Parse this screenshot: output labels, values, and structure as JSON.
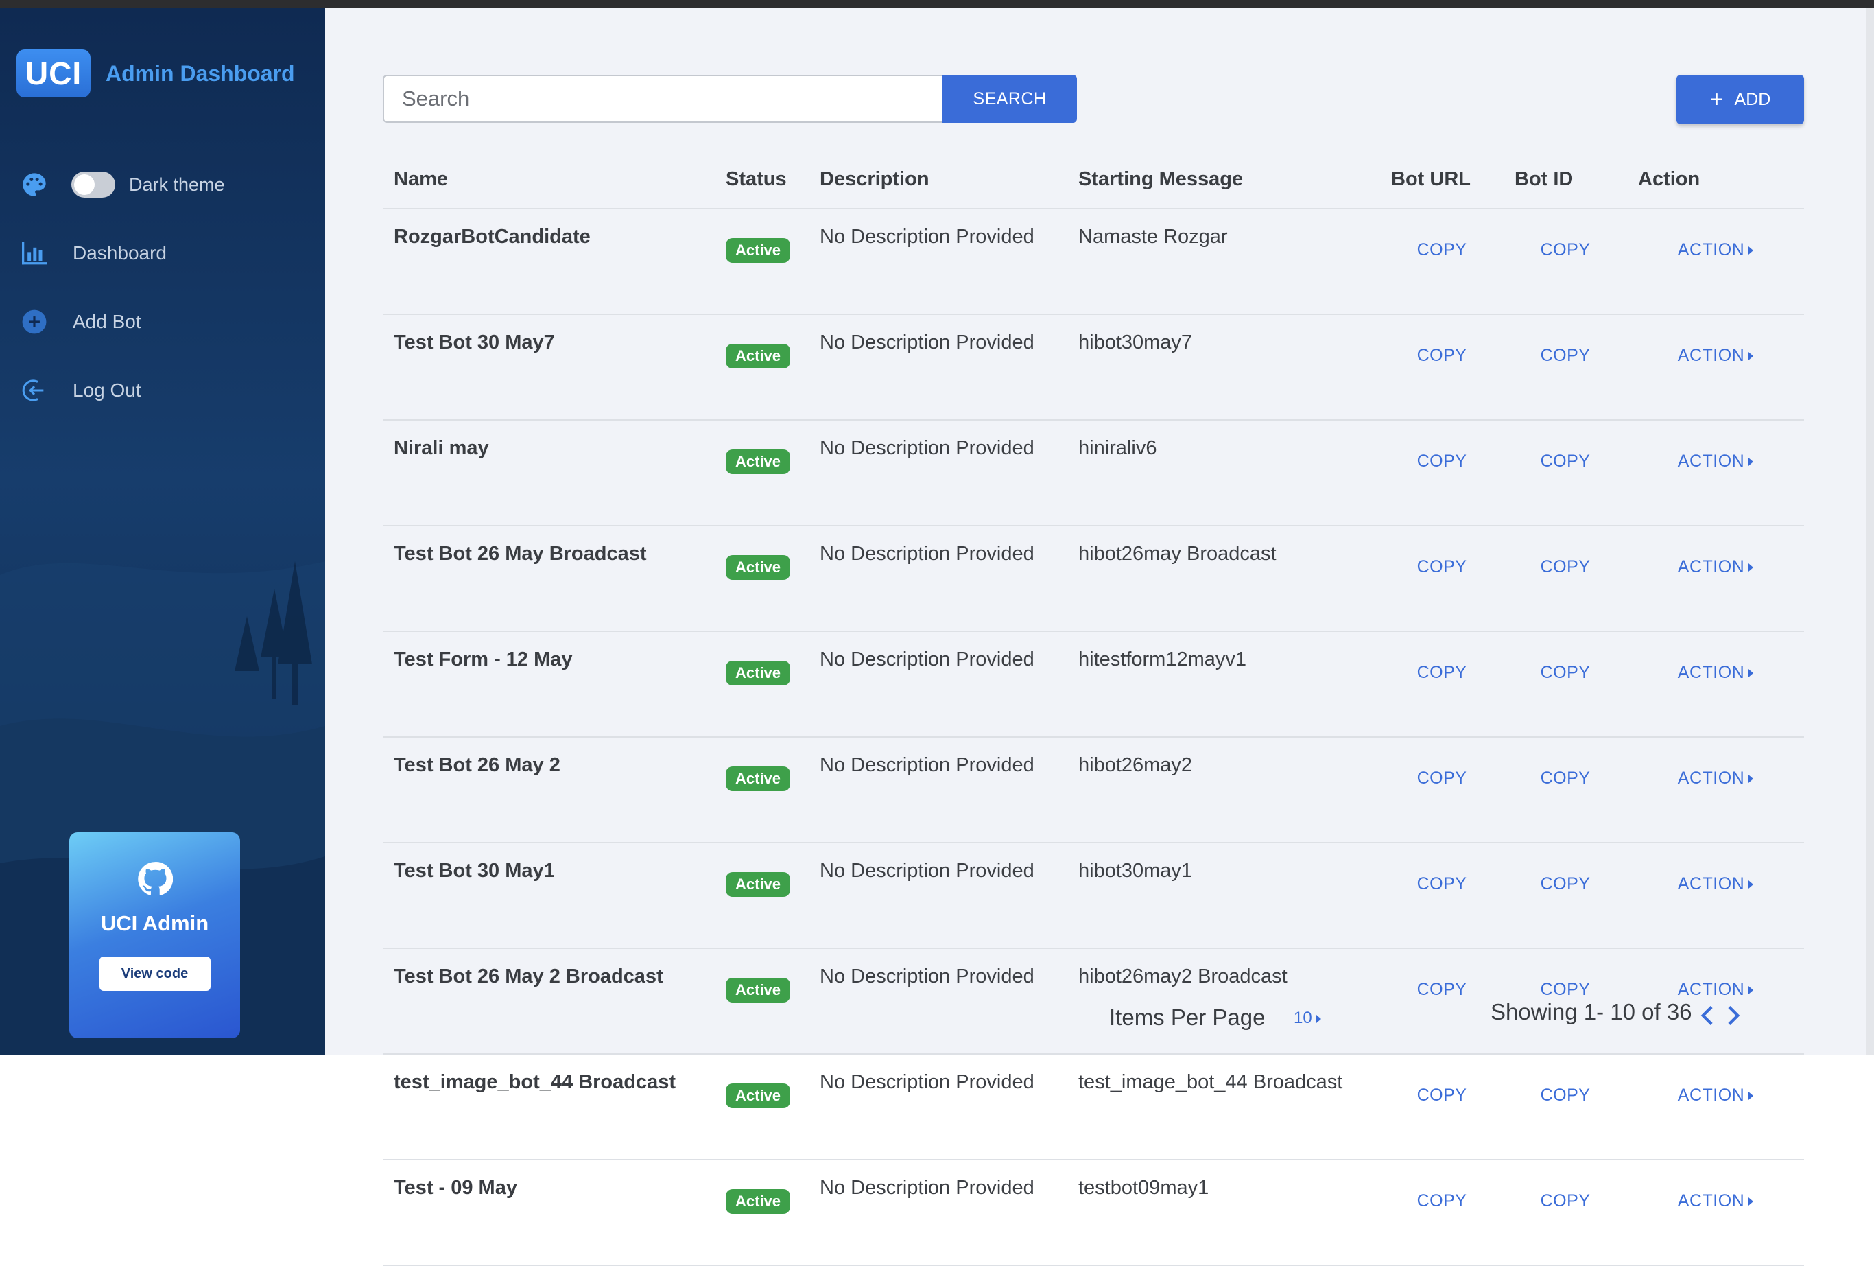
{
  "app": {
    "logo_text": "UCI",
    "title": "Admin Dashboard"
  },
  "sidebar": {
    "theme_toggle": {
      "label": "Dark theme",
      "enabled": false
    },
    "items": [
      {
        "label": "Dashboard",
        "icon": "bar-chart-icon"
      },
      {
        "label": "Add Bot",
        "icon": "plus-circle-icon"
      },
      {
        "label": "Log Out",
        "icon": "logout-icon"
      }
    ],
    "promo": {
      "title": "UCI Admin",
      "button": "View code",
      "icon": "github-icon"
    }
  },
  "toolbar": {
    "search_placeholder": "Search",
    "search_button": "SEARCH",
    "add_button": "ADD"
  },
  "table": {
    "columns": [
      "Name",
      "Status",
      "Description",
      "Starting Message",
      "Bot URL",
      "Bot ID",
      "Action"
    ],
    "rows": [
      {
        "name": "RozgarBotCandidate",
        "status": "Active",
        "description": "No Description Provided",
        "starting_message": "Namaste Rozgar",
        "bot_url": "COPY",
        "bot_id": "COPY",
        "action": "ACTION"
      },
      {
        "name": "Test Bot 30 May7",
        "status": "Active",
        "description": "No Description Provided",
        "starting_message": "hibot30may7",
        "bot_url": "COPY",
        "bot_id": "COPY",
        "action": "ACTION"
      },
      {
        "name": "Nirali may",
        "status": "Active",
        "description": "No Description Provided",
        "starting_message": "hiniraliv6",
        "bot_url": "COPY",
        "bot_id": "COPY",
        "action": "ACTION"
      },
      {
        "name": "Test Bot 26 May Broadcast",
        "status": "Active",
        "description": "No Description Provided",
        "starting_message": "hibot26may Broadcast",
        "bot_url": "COPY",
        "bot_id": "COPY",
        "action": "ACTION"
      },
      {
        "name": "Test Form - 12 May",
        "status": "Active",
        "description": "No Description Provided",
        "starting_message": "hitestform12mayv1",
        "bot_url": "COPY",
        "bot_id": "COPY",
        "action": "ACTION"
      },
      {
        "name": "Test Bot 26 May 2",
        "status": "Active",
        "description": "No Description Provided",
        "starting_message": "hibot26may2",
        "bot_url": "COPY",
        "bot_id": "COPY",
        "action": "ACTION"
      },
      {
        "name": "Test Bot 30 May1",
        "status": "Active",
        "description": "No Description Provided",
        "starting_message": "hibot30may1",
        "bot_url": "COPY",
        "bot_id": "COPY",
        "action": "ACTION"
      },
      {
        "name": "Test Bot 26 May 2 Broadcast",
        "status": "Active",
        "description": "No Description Provided",
        "starting_message": "hibot26may2 Broadcast",
        "bot_url": "COPY",
        "bot_id": "COPY",
        "action": "ACTION"
      },
      {
        "name": "test_image_bot_44 Broadcast",
        "status": "Active",
        "description": "No Description Provided",
        "starting_message": "test_image_bot_44 Broadcast",
        "bot_url": "COPY",
        "bot_id": "COPY",
        "action": "ACTION"
      },
      {
        "name": "Test - 09 May",
        "status": "Active",
        "description": "No Description Provided",
        "starting_message": "testbot09may1",
        "bot_url": "COPY",
        "bot_id": "COPY",
        "action": "ACTION"
      }
    ]
  },
  "pagination": {
    "items_per_page_label": "Items Per Page",
    "items_per_page_value": "10",
    "showing": "Showing 1- 10 of 36"
  },
  "colors": {
    "accent": "#3a6cd8",
    "active_badge": "#3ea04a",
    "sidebar_bg": "#12325c",
    "logo_text": "#4a9df0"
  }
}
